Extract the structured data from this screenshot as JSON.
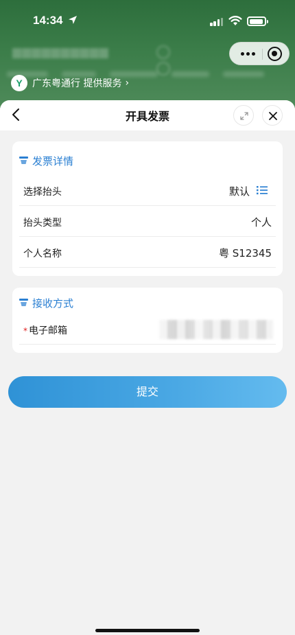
{
  "status_bar": {
    "time": "14:34"
  },
  "provider": {
    "logo_letter": "Y",
    "text": "广东粤通行 提供服务",
    "chevron": "›"
  },
  "sheet": {
    "title": "开具发票",
    "invoice_details": {
      "section_title": "发票详情",
      "rows": [
        {
          "label": "选择抬头",
          "value": "默认"
        },
        {
          "label": "抬头类型",
          "value": "个人"
        },
        {
          "label": "个人名称",
          "value": "粤 S12345"
        }
      ]
    },
    "receive_method": {
      "section_title": "接收方式",
      "required_mark": "*",
      "email_label": "电子邮箱"
    },
    "submit_label": "提交"
  },
  "colors": {
    "accent": "#2a7fd2",
    "header_green": "#3b7d49",
    "button_gradient_start": "#2f92d6",
    "button_gradient_end": "#64bbef"
  },
  "icons": [
    "location-arrow-icon",
    "signal-icon",
    "wifi-icon",
    "battery-icon",
    "more-icon",
    "close-circle-icon",
    "back-icon",
    "expand-icon",
    "close-icon",
    "section-icon",
    "list-icon"
  ]
}
